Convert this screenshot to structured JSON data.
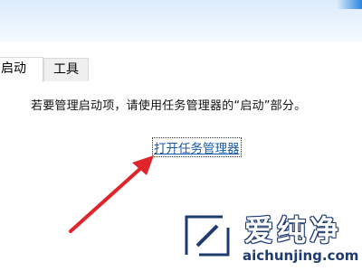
{
  "tabs": [
    {
      "label": "启动",
      "active": true
    },
    {
      "label": "工具",
      "active": false
    }
  ],
  "message": "若要管理启动项，请使用任务管理器的“启动”部分。",
  "link_label": "打开任务管理器",
  "colors": {
    "link": "#1a5aa8",
    "arrow": "#e0242b",
    "watermark": "#1e3b70",
    "topbar": "#dcecfb"
  },
  "watermark": {
    "brand_cn": "爱纯净",
    "brand_en": "aichunjing.com"
  }
}
